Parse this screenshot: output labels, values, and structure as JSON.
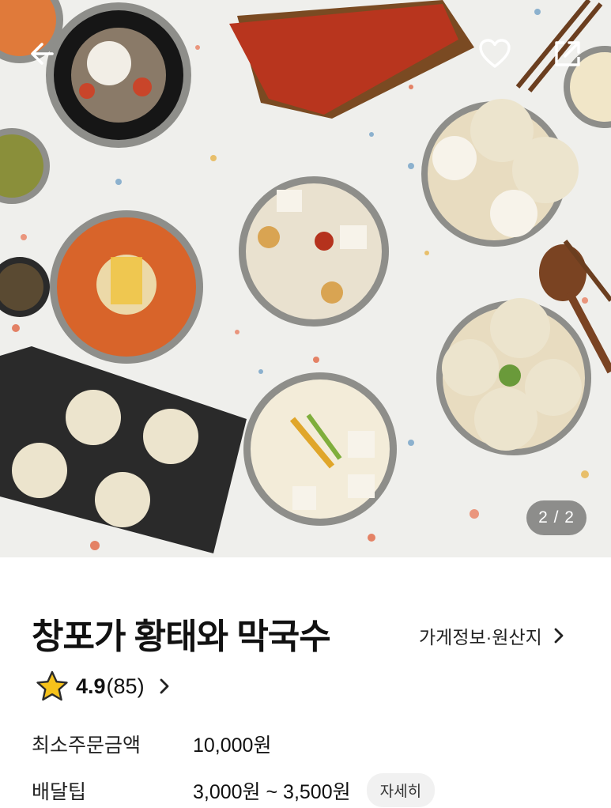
{
  "photo": {
    "counter": "2 / 2",
    "colors": {
      "tabletop": "#efefec",
      "bowl_rim": "#8e8e8a",
      "red_soup": "#d8642a",
      "white_soup": "#e9e1cf",
      "dumpling": "#ece4cd",
      "tray": "#2a2a2a",
      "grilled_fish": "#b8351e"
    },
    "icons": {
      "back": "back-arrow-icon",
      "like": "heart-icon",
      "share": "share-icon"
    }
  },
  "store": {
    "name": "창포가 황태와 막국수",
    "info_link": "가게정보·원산지",
    "rating": "4.9",
    "review_count": "(85)"
  },
  "delivery": {
    "min_order_label": "최소주문금액",
    "min_order_value": "10,000원",
    "tip_label": "배달팁",
    "tip_value": "3,000원 ~ 3,500원",
    "detail_button": "자세히"
  },
  "accent": {
    "star": "#f6c21b",
    "star_stroke": "#2b2b2b"
  }
}
